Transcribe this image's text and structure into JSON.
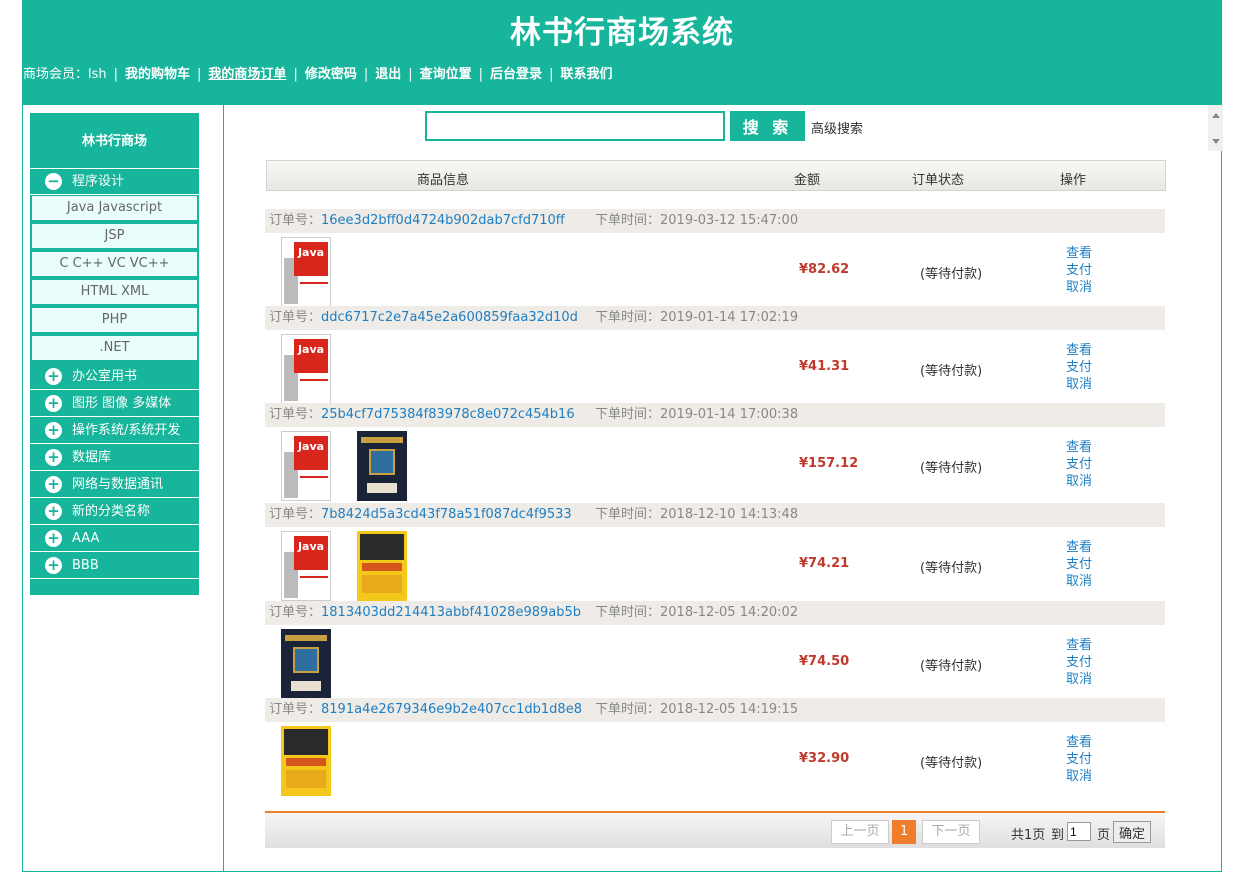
{
  "header": {
    "title": "林书行商场系统",
    "nav": {
      "member": "商场会员：lsh",
      "cart": "我的购物车",
      "orders": "我的商场订单",
      "password": "修改密码",
      "logout": "退出",
      "location": "查询位置",
      "admin": "后台登录",
      "contact": "联系我们",
      "separator": "|"
    }
  },
  "sidebar": {
    "title": "林书行商场",
    "categories": [
      {
        "label": "程序设计",
        "icon": "minus-circle-icon",
        "expanded": true
      },
      {
        "label": "办公室用书",
        "icon": "plus-circle-icon"
      },
      {
        "label": "图形 图像 多媒体",
        "icon": "plus-circle-icon"
      },
      {
        "label": "操作系统/系统开发",
        "icon": "plus-circle-icon"
      },
      {
        "label": "数据库",
        "icon": "plus-circle-icon"
      },
      {
        "label": "网络与数据通讯",
        "icon": "plus-circle-icon"
      },
      {
        "label": "新的分类名称",
        "icon": "plus-circle-icon"
      },
      {
        "label": "AAA",
        "icon": "plus-circle-icon"
      },
      {
        "label": "BBB",
        "icon": "plus-circle-icon"
      }
    ],
    "subcategories": [
      "Java Javascript",
      "JSP",
      "C C++ VC VC++",
      "HTML XML",
      "PHP",
      ".NET"
    ],
    "icons": {
      "minus": "−",
      "plus": "+"
    }
  },
  "search": {
    "value": "",
    "button": "搜 索",
    "advanced": "高级搜索"
  },
  "table": {
    "headers": {
      "info": "商品信息",
      "amount": "金额",
      "status": "订单状态",
      "action": "操作"
    }
  },
  "labels": {
    "order_no": "订单号：",
    "order_time": "下单时间：",
    "view": "查看",
    "pay": "支付",
    "cancel": "取消"
  },
  "orders": [
    {
      "id": "16ee3d2bff0d4724b902dab7cfd710ff",
      "time": "2019-03-12 15:47:00",
      "amount": "¥82.62",
      "status": "(等待付款)",
      "books": [
        "java-book-cover"
      ]
    },
    {
      "id": "ddc6717c2e7a45e2a600859faa32d10d",
      "time": "2019-01-14 17:02:19",
      "amount": "¥41.31",
      "status": "(等待付款)",
      "books": [
        "java-book-cover"
      ]
    },
    {
      "id": "25b4cf7d75384f83978c8e072c454b16",
      "time": "2019-01-14 17:00:38",
      "amount": "¥157.12",
      "status": "(等待付款)",
      "books": [
        "java-book-cover",
        "thinking-java-cover"
      ]
    },
    {
      "id": "7b8424d5a3cd43f78a51f087dc4f9533",
      "time": "2018-12-10 14:13:48",
      "amount": "¥74.21",
      "status": "(等待付款)",
      "books": [
        "java-book-cover",
        "web-design-cover"
      ]
    },
    {
      "id": "1813403dd214413abbf41028e989ab5b",
      "time": "2018-12-05 14:20:02",
      "amount": "¥74.50",
      "status": "(等待付款)",
      "books": [
        "thinking-java-cover"
      ]
    },
    {
      "id": "8191a4e2679346e9b2e407cc1db1d8e8",
      "time": "2018-12-05 14:19:15",
      "amount": "¥32.90",
      "status": "(等待付款)",
      "books": [
        "web-design-cover"
      ]
    }
  ],
  "pager": {
    "prev": "上一页",
    "current": "1",
    "next": "下一页",
    "total": "共1页",
    "to": "到",
    "input": "1",
    "unit": "页",
    "go": "确定"
  },
  "colors": {
    "brand": "#17b59b",
    "price": "#c0392b",
    "link": "#1e7fc2",
    "pager_accent": "#ef7d2b"
  }
}
